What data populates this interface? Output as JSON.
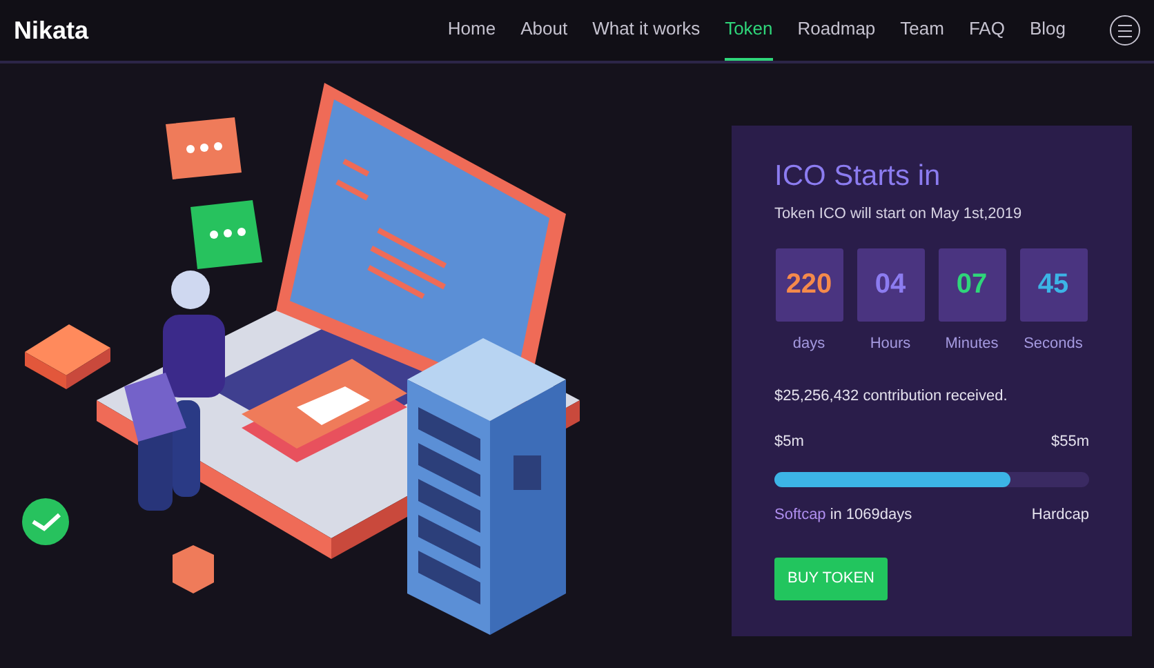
{
  "brand": "Nikata",
  "nav": [
    {
      "label": "Home",
      "selected": false
    },
    {
      "label": "About",
      "selected": false
    },
    {
      "label": "What it works",
      "selected": false
    },
    {
      "label": "Token",
      "selected": true
    },
    {
      "label": "Roadmap",
      "selected": false
    },
    {
      "label": "Team",
      "selected": false
    },
    {
      "label": "FAQ",
      "selected": false
    },
    {
      "label": "Blog",
      "selected": false
    }
  ],
  "ico": {
    "title": "ICO Starts in",
    "subtitle": "Token ICO will start on May 1st,2019",
    "countdown": [
      {
        "value": "220",
        "unit": "days",
        "color": "#f58a4b"
      },
      {
        "value": "04",
        "unit": "Hours",
        "color": "#8c7cf0"
      },
      {
        "value": "07",
        "unit": "Minutes",
        "color": "#2fd67a"
      },
      {
        "value": "45",
        "unit": "Seconds",
        "color": "#3cb4e6"
      }
    ],
    "contribution": "$25,256,432 contribution received.",
    "min": "$5m",
    "max": "$55m",
    "level": 0.75,
    "softcap": "Softcap",
    "softcap_note": "in 1069days",
    "hardcap": "Hardcap",
    "button": "BUY TOKEN"
  }
}
